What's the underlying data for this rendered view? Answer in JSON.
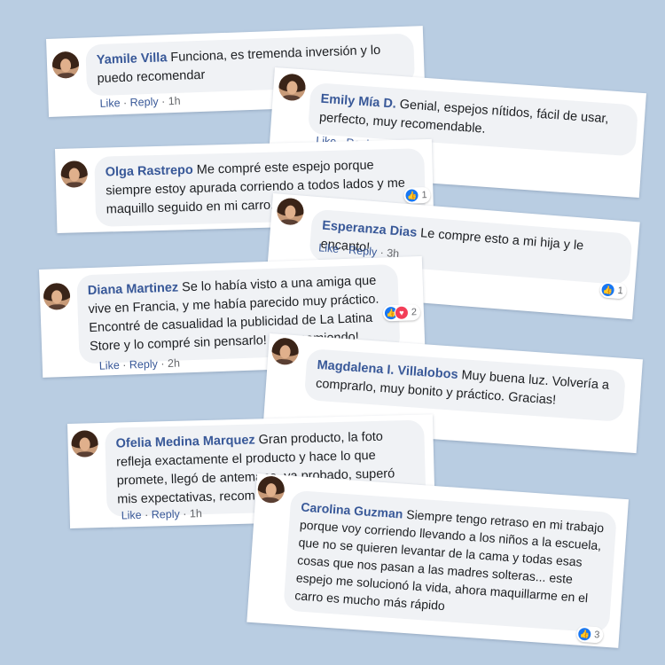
{
  "actions": {
    "like": "Like",
    "reply": "Reply",
    "dot": "·"
  },
  "comments": [
    {
      "name": "Yamile Villa",
      "text": "Funciona, es tremenda inversión y lo puedo recomendar",
      "time": "1h"
    },
    {
      "name": "Emily Mía D.",
      "text": "Genial, espejos nítidos, fácil de usar, perfecto, muy recomendable.",
      "time": ""
    },
    {
      "name": "Olga Rastrepo",
      "text": "Me compré este espejo porque siempre estoy apurada corriendo a todos lados y me maquillo seguido en mi carro. Me encanto",
      "time": "",
      "reactions": "1"
    },
    {
      "name": "Esperanza Dias",
      "text": "Le compre esto a mi hija y le encanto!",
      "time": "3h",
      "reactions": "1"
    },
    {
      "name": "Diana Martinez",
      "text": "Se lo había visto a una amiga que vive en Francia, y me había parecido muy práctico. Encontré de casualidad la publicidad de La Latina Store y lo compré sin pensarlo! Lo recomiendo!",
      "time": "2h",
      "reactions": "2"
    },
    {
      "name": "Magdalena I. Villalobos",
      "text": "Muy buena luz. Volvería a comprarlo, muy bonito y práctico. Gracias!",
      "time": ""
    },
    {
      "name": "Ofelia Medina Marquez",
      "text": "Gran producto, la foto refleja exactamente el producto y hace lo que promete, llegó de antemano, ya probado, superó mis expectativas, recomendado.",
      "time": "1h"
    },
    {
      "name": "Carolina Guzman",
      "text": "Siempre tengo retraso en mi trabajo porque voy corriendo llevando a los niños a la escuela, que no se quieren levantar de la cama y todas esas cosas que nos pasan a las madres solteras... este espejo me solucionó la vida, ahora maquillarme en el carro es mucho más rápido",
      "time": "",
      "reactions": "3"
    }
  ],
  "colors": {
    "background": "#b9cde2",
    "name": "#385898",
    "bubble": "#f0f2f5",
    "like": "#1877f2",
    "love": "#f33e58"
  },
  "icons": {
    "like": "like-icon",
    "love": "love-icon"
  }
}
